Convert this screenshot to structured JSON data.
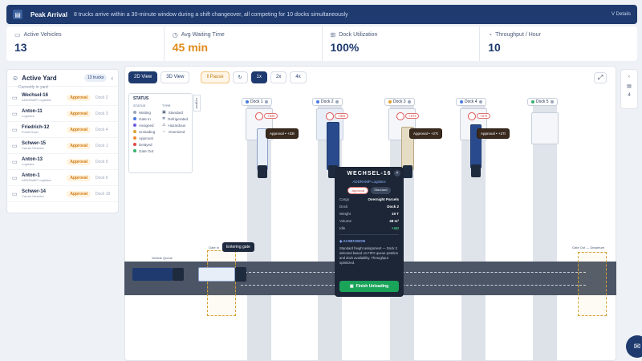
{
  "banner": {
    "title": "Peak Arrival",
    "description": "8 trucks arrive within a 30-minute window during a shift changeover, all competing for 10 docks simultaneously",
    "details_label": "V Details"
  },
  "kpis": [
    {
      "label": "Active Vehicles",
      "value": "13",
      "icon": "truck-icon"
    },
    {
      "label": "Avg Waiting Time",
      "value": "45 min",
      "icon": "clock-icon"
    },
    {
      "label": "Dock Utilization",
      "value": "100%",
      "icon": "dock-icon"
    },
    {
      "label": "Throughput / Hour",
      "value": "10",
      "icon": "throughput-icon"
    }
  ],
  "yard": {
    "title": "Active Yard",
    "subtitle": "Currently in yard",
    "count_badge": "13 trucks",
    "trucks": [
      {
        "name": "Wechsel-16",
        "company": "ADDRAMP Logistics",
        "status": "Approval",
        "dock": "Dock 2"
      },
      {
        "name": "Anton-11",
        "company": "Logistics",
        "status": "Approval",
        "dock": "Dock 3"
      },
      {
        "name": "Friedrich-12",
        "company": "FreshChain",
        "status": "Approval",
        "dock": "Dock 4"
      },
      {
        "name": "Schwer-15",
        "company": "Carrier Heavies",
        "status": "Approval",
        "dock": "Dock 1"
      },
      {
        "name": "Anton-13",
        "company": "Logistics",
        "status": "Approval",
        "dock": "Dock 5"
      },
      {
        "name": "Anton-1",
        "company": "ADDRAMP Logistics",
        "status": "Approval",
        "dock": "Dock 6"
      },
      {
        "name": "Schwer-14",
        "company": "Carrier Heavies",
        "status": "Approval",
        "dock": "Dock 10"
      }
    ]
  },
  "toolbar": {
    "view_2d": "2D View",
    "view_3d": "3D View",
    "pause": "Pause",
    "speed_1x": "1x",
    "speed_2x": "2x",
    "speed_4x": "4x"
  },
  "legend": {
    "title": "STATUS",
    "tab_label": "Legend",
    "status_header": "STATUS",
    "type_header": "TYPE",
    "statuses": [
      {
        "label": "Waiting",
        "color": "#9aa6bb"
      },
      {
        "label": "Gate In",
        "color": "#4a7ae0"
      },
      {
        "label": "Assigned",
        "color": "#6a5ae0"
      },
      {
        "label": "Unloading",
        "color": "#e0a030"
      },
      {
        "label": "Approval",
        "color": "#f08a2a"
      },
      {
        "label": "Delayed",
        "color": "#e04a4a"
      },
      {
        "label": "Gate Out",
        "color": "#3ab070"
      }
    ],
    "types": [
      {
        "label": "Standard",
        "icon": "standard-icon"
      },
      {
        "label": "Refrigerated",
        "icon": "snowflake-icon"
      },
      {
        "label": "Hazardous",
        "icon": "hazard-icon"
      },
      {
        "label": "Oversized",
        "icon": "oversized-icon"
      }
    ]
  },
  "docks": [
    {
      "label": "Dock 1",
      "timer": "+33t",
      "tag": "Approval • +33t"
    },
    {
      "label": "Dock 2",
      "timer": "+34t",
      "tag": ""
    },
    {
      "label": "Dock 3",
      "timer": "+27t",
      "tag": "Approval • +27t"
    },
    {
      "label": "Dock 4",
      "timer": "+27t",
      "tag": "Approval • +27t"
    },
    {
      "label": "Dock 5",
      "timer": "",
      "tag": ""
    }
  ],
  "gates": {
    "gate_in_label": "Gate In",
    "gate_out_label": "Gate Out — Departure",
    "queue_label": "Vehicle Queue",
    "entering_label": "Entering gate",
    "arrival_label": "ARRIVAL",
    "depart_label": "DEPART"
  },
  "popup": {
    "title": "WECHSEL-16",
    "company": "ADDRAMP Logistics",
    "tag_status": "Approval",
    "tag_type": "Standard",
    "rows": [
      {
        "label": "Cargo",
        "value": "Overnight Parcels"
      },
      {
        "label": "Dock",
        "value": "Dock 2"
      },
      {
        "label": "Weight",
        "value": "19 T"
      },
      {
        "label": "Volume",
        "value": "48 m³"
      },
      {
        "label": "Idle",
        "value": "+34t"
      }
    ],
    "ai_title": "AI DECISION",
    "ai_text": "Standard freight assignment — Dock 2 selected based on FIFO queue position and dock availability. Throughput optimized.",
    "finish_button": "Finish Unloading"
  },
  "right_strip": {
    "count": "4"
  }
}
